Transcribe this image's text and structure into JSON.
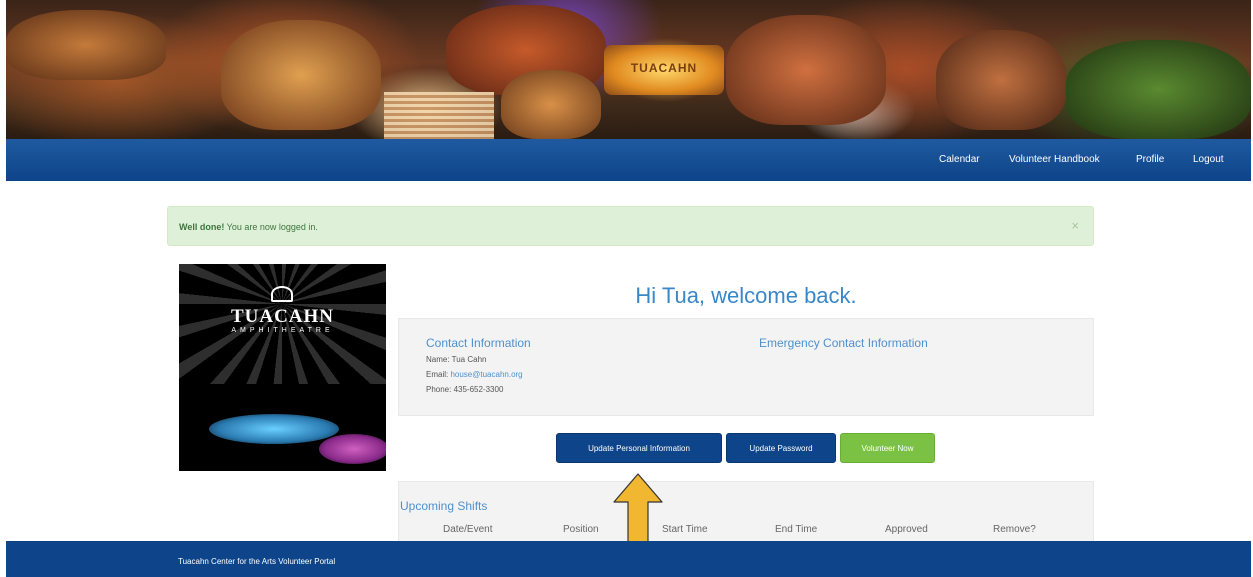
{
  "banner": {
    "sign_text": "TUACAHN"
  },
  "nav": {
    "items": [
      {
        "label": "Calendar"
      },
      {
        "label": "Volunteer Handbook"
      },
      {
        "label": "Profile"
      },
      {
        "label": "Logout"
      }
    ]
  },
  "alert": {
    "strong": "Well done!",
    "text": " You are now logged in.",
    "close": "×"
  },
  "logo": {
    "title": "TUACAHN",
    "subtitle": "AMPHITHEATRE"
  },
  "welcome": {
    "heading": "Hi Tua, welcome back."
  },
  "contact": {
    "heading": "Contact Information",
    "name_label": "Name: ",
    "name": "Tua Cahn",
    "email_label": "Email: ",
    "email": "house@tuacahn.org",
    "phone_label": "Phone: ",
    "phone": "435-652-3300"
  },
  "emergency": {
    "heading": "Emergency Contact Information"
  },
  "buttons": {
    "update_personal": "Update Personal Information",
    "update_password": "Update Password",
    "volunteer_now": "Volunteer Now"
  },
  "shifts": {
    "heading": "Upcoming Shifts",
    "columns": [
      "Date/Event",
      "Position",
      "Start Time",
      "End Time",
      "Approved",
      "Remove?"
    ]
  },
  "footer": {
    "text": "Tuacahn Center for the Arts Volunteer Portal"
  },
  "colors": {
    "brand_blue": "#0e4489",
    "link_blue": "#4f90cc",
    "success_bg": "#dff0d8",
    "green_button": "#7bc143",
    "arrow_yellow": "#f2b731"
  }
}
